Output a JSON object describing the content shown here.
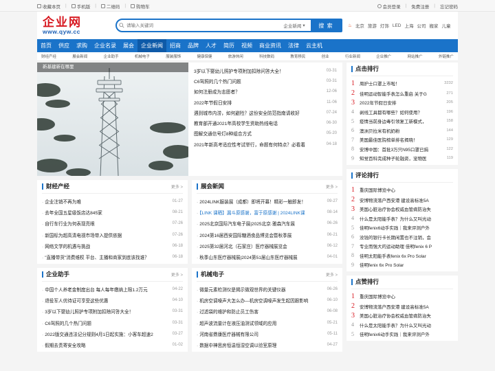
{
  "topbar": {
    "left": [
      "收藏本页",
      "手机版",
      "二维码",
      "购物车"
    ],
    "right": [
      "会员登录",
      "免费注册",
      "忘记密码"
    ]
  },
  "logo": {
    "cn": "企业网",
    "en": "www.qyw.cc"
  },
  "search": {
    "placeholder": "请输入关键词",
    "category": "企业新闻",
    "button": "搜 索"
  },
  "hot": [
    "北京",
    "旅游",
    "灯饰",
    "LED",
    "上海",
    "公司",
    "搬家",
    "儿童"
  ],
  "nav": [
    "首页",
    "供应",
    "求购",
    "企业名录",
    "展会",
    "企业新闻",
    "招商",
    "品牌",
    "人才",
    "简历",
    "视频",
    "商业资讯",
    "法律",
    "云主机"
  ],
  "nav_active": 5,
  "subnav": [
    "财经产经",
    "展会新闻",
    "企业助手",
    "机械电子",
    "服装服饰",
    "健康保健",
    "旅游休闲",
    "科技数码",
    "教育移民",
    "创业",
    "行业新闻",
    "企业推广",
    "网站推广",
    "外链推广"
  ],
  "photo_caption": "新基建新在哪里",
  "headlines": [
    {
      "t": "3岁以下婴幼儿照护专项附加扣除问答大全！",
      "d": "03-31"
    },
    {
      "t": "C6驾照的几个热门问题",
      "d": "03-31"
    },
    {
      "t": "如何注册成为志愿者？",
      "d": "12-06"
    },
    {
      "t": "2022年节假日安排",
      "d": "11-06"
    },
    {
      "t": "遇到城市内涝，如何避险？这份安全防范指南请收好",
      "d": "07-24"
    },
    {
      "t": "教育部开通2021年高校学生资助热线电话",
      "d": "06-30"
    },
    {
      "t": "图解交通信号灯8种组合方式",
      "d": "05-20"
    },
    {
      "t": "2021年新高考适应性考试举行，命题有何特点？必看着",
      "d": "04-18"
    }
  ],
  "boxes": [
    {
      "title": "财经产经",
      "more": "更多 >",
      "items": [
        {
          "t": "企业注销不再为难",
          "d": "01-27"
        },
        {
          "t": "去年全国五星级饭店达845家",
          "d": "08-21"
        },
        {
          "t": "自行车行业为何表现亮眼",
          "d": "07-26"
        },
        {
          "t": "新国标为超高清电视市场带入提供依据",
          "d": "07-26"
        },
        {
          "t": "网络文学的机遇与挑战",
          "d": "06-18"
        },
        {
          "t": "\"直播带货\"消费维权 平台、主播和商家到底该找谁？",
          "d": "06-18"
        }
      ]
    },
    {
      "title": "展会新闻",
      "more": "更多 >",
      "items": [
        {
          "t": "2024LINK服装展（成都）即将开幕！精彩一触即发！",
          "d": "09-27"
        },
        {
          "t": "【LINK 课晒】漏斗原感谢，富于原感谢 | 2024LINK课",
          "d": "08-14",
          "hi": true
        },
        {
          "t": "2025北京国际汽车电子展|2025北京·雅森汽车展",
          "d": "06-26"
        },
        {
          "t": "2024第16届西安国际糖酒食品博览会暨秋季展",
          "d": "06-21"
        },
        {
          "t": "2025第32届河北（石家庄）医疗器械展览会",
          "d": "06-12"
        },
        {
          "t": "秋季山东医疗器械展|2024第51届山东医疗器械展",
          "d": "04-01"
        }
      ]
    },
    {
      "title": "企业助手",
      "more": "更多 >",
      "items": [
        {
          "t": "中国个人养老金制度出台 每人每年缴纳上限1.2万元",
          "d": "04-22"
        },
        {
          "t": "退役军人优待证可享受这些优惠",
          "d": "04-10"
        },
        {
          "t": "3岁以下婴幼儿照护专项附加扣除问答大全！",
          "d": "03-31"
        },
        {
          "t": "C6驾照的几个热门问题",
          "d": "03-31"
        },
        {
          "t": "2022版交通违法记分规则4月1日起实施：小客车超速2",
          "d": "03-27"
        },
        {
          "t": "假期去责寄安全攻略",
          "d": "01-02"
        }
      ]
    },
    {
      "title": "机械电子",
      "more": "更多 >",
      "items": [
        {
          "t": "微量元素检测仪是揭示微观世界的关键仪器",
          "d": "06-26"
        },
        {
          "t": "机房空调噪声大怎么办—机房空调噪声发生起因跟影响",
          "d": "06-10"
        },
        {
          "t": "过滤袋的维护和防止员工伤害",
          "d": "06-08"
        },
        {
          "t": "超声波流量计在液压油测试领域的应用",
          "d": "05-21"
        },
        {
          "t": "河南省鼎康医疗器械有限公司",
          "d": "05-11"
        },
        {
          "t": "数据中神思房恒温恒湿空调以验室原理",
          "d": "04-27"
        }
      ]
    }
  ],
  "rank_click": {
    "title": "点击排行",
    "items": [
      {
        "n": "1",
        "t": "周护士口罩上市啦！",
        "c": "3232"
      },
      {
        "n": "2",
        "t": "佳明运动智能手表怎么重启 关于G",
        "c": "271"
      },
      {
        "n": "3",
        "t": "2022年节假日安排",
        "c": "205"
      },
      {
        "n": "4",
        "t": "剥线工具都有哪些？如何使用？",
        "c": "196"
      },
      {
        "n": "5",
        "t": "疫情当前身边毒引领复工新模式，",
        "c": "158"
      },
      {
        "n": "6",
        "t": "澳洲贝拉米有机奶粉",
        "c": "144"
      },
      {
        "n": "7",
        "t": "美国最佳医院榜单排名揭晓！",
        "c": "129"
      },
      {
        "n": "8",
        "t": "安博中国：首批3万只N95口罩已捐",
        "c": "122"
      },
      {
        "n": "9",
        "t": "知觉百科完成种子轮融资，宠物医",
        "c": "119"
      }
    ]
  },
  "rank_comment": {
    "title": "评论排行",
    "items": [
      {
        "n": "1",
        "t": "重庆国际博览中心"
      },
      {
        "n": "2",
        "t": "安博物流落户西安港 建设高标准5A"
      },
      {
        "n": "3",
        "t": "美国心脏治疗协会权威血管病防治失"
      },
      {
        "n": "4",
        "t": "什么是太阳能手表？为什么又叫光动"
      },
      {
        "n": "5",
        "t": "佳明fenix6动手实践｜我来评测户外"
      },
      {
        "n": "6",
        "t": "没钱的银行卡长期闲置也不注销，会"
      },
      {
        "n": "7",
        "t": "专业而强大的运动助理 佳明fenix 6 P"
      },
      {
        "n": "8",
        "t": "佳明太阳能手表fenix 6x Pro Solar"
      },
      {
        "n": "9",
        "t": "佳明fenix 6x Pro Solar"
      }
    ]
  },
  "rank_free": {
    "title": "点赞排行",
    "items": [
      {
        "n": "1",
        "t": "重庆国际博览中心"
      },
      {
        "n": "2",
        "t": "安博物流落户西安港 建设高标准5A"
      },
      {
        "n": "3",
        "t": "美国心脏治疗协会权威血管病防治失"
      },
      {
        "n": "4",
        "t": "什么是太阳能手表？为什么又叫光动"
      },
      {
        "n": "5",
        "t": "佳明fenix6动手实践｜我来评测户外"
      }
    ]
  }
}
